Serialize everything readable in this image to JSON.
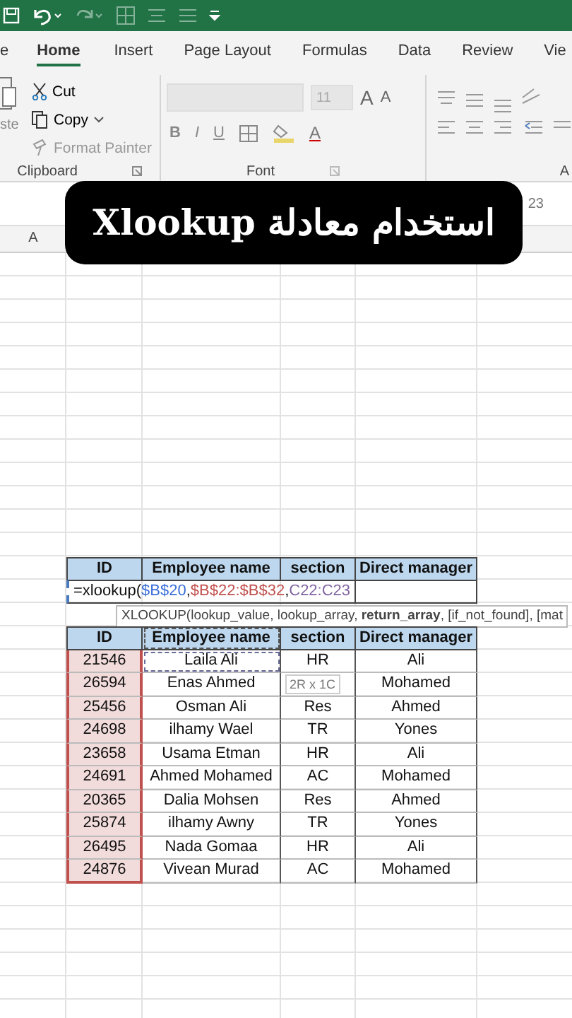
{
  "tabs": [
    {
      "label": "e",
      "selected": false
    },
    {
      "label": "Home",
      "selected": true
    },
    {
      "label": "Insert",
      "selected": false
    },
    {
      "label": "Page Layout",
      "selected": false
    },
    {
      "label": "Formulas",
      "selected": false
    },
    {
      "label": "Data",
      "selected": false
    },
    {
      "label": "Review",
      "selected": false
    },
    {
      "label": "Vie",
      "selected": false
    }
  ],
  "clipboard": {
    "paste": "ste",
    "items": [
      {
        "kind": "cut",
        "label": "Cut",
        "disabled": false
      },
      {
        "kind": "copy",
        "label": "Copy",
        "disabled": false
      },
      {
        "kind": "painter",
        "label": "Format Painter",
        "disabled": true
      }
    ],
    "label": "Clipboard"
  },
  "font": {
    "size": "11",
    "grow": "A",
    "shrink": "A",
    "styles": [
      "B",
      "I",
      "U"
    ],
    "color_letter": "A",
    "label": "Font"
  },
  "alignment": {
    "label": "A"
  },
  "formula_bar": {
    "text": "23"
  },
  "column_header": "A",
  "banner": "استخدام معادلة Xlookup",
  "lookup_table": {
    "headers": [
      "ID",
      "Employee name",
      "section",
      "Direct manager"
    ],
    "formula": [
      {
        "text": "=xlookup("
      },
      {
        "text": "$B$20",
        "color": "#3a6fd8"
      },
      {
        "text": ","
      },
      {
        "text": "$B$22:$B$32",
        "color": "#c0504d"
      },
      {
        "text": ","
      },
      {
        "text": "C22:C23",
        "color": "#8064a2"
      }
    ],
    "tooltip": "XLOOKUP(lookup_value, lookup_array, **return_array**, [if_not_found], [mat"
  },
  "table": {
    "headers": [
      "ID",
      "Employee name",
      "section",
      "Direct manager"
    ],
    "rows": [
      {
        "id": "21546",
        "name": "Laila Ali",
        "section": "HR",
        "manager": "Ali",
        "marquee": true
      },
      {
        "id": "26594",
        "name": "Enas Ahmed",
        "tip": "2R x 1C",
        "manager": "Mohamed",
        "marquee": false
      },
      {
        "id": "25456",
        "name": "Osman Ali",
        "section": "Res",
        "manager": "Ahmed",
        "marquee": false
      },
      {
        "id": "24698",
        "name": "ilhamy Wael",
        "section": "TR",
        "manager": "Yones",
        "marquee": false
      },
      {
        "id": "23658",
        "name": "Usama Etman",
        "section": "HR",
        "manager": "Ali",
        "marquee": false
      },
      {
        "id": "24691",
        "name": "Ahmed Mohamed",
        "section": "AC",
        "manager": "Mohamed",
        "marquee": false
      },
      {
        "id": "20365",
        "name": "Dalia Mohsen",
        "section": "Res",
        "manager": "Ahmed",
        "marquee": false
      },
      {
        "id": "25874",
        "name": "ilhamy Awny",
        "section": "TR",
        "manager": "Yones",
        "marquee": false
      },
      {
        "id": "26495",
        "name": "Nada Gomaa",
        "section": "HR",
        "manager": "Ali",
        "marquee": false
      },
      {
        "id": "24876",
        "name": "Vivean Murad",
        "section": "AC",
        "manager": "Mohamed",
        "marquee": false
      }
    ]
  }
}
